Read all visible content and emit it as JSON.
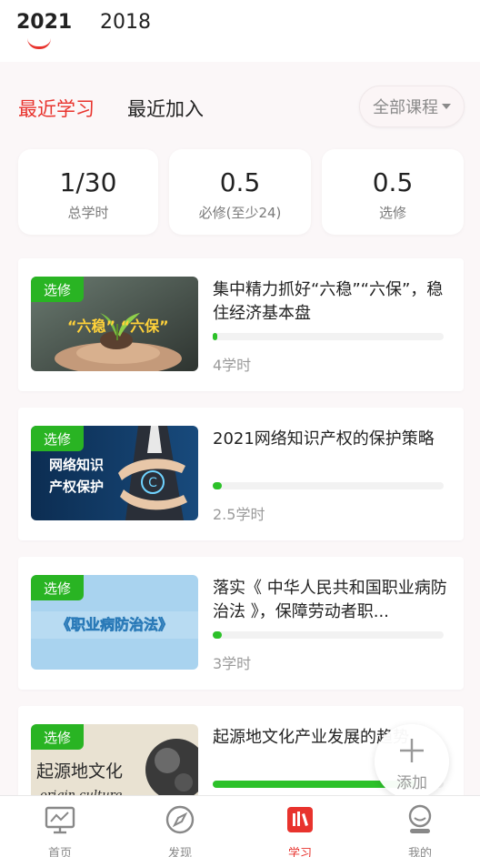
{
  "year_tabs": [
    {
      "label": "2021",
      "active": true
    },
    {
      "label": "2018",
      "active": false
    }
  ],
  "sub_tabs": [
    {
      "label": "最近学习",
      "active": true
    },
    {
      "label": "最近加入",
      "active": false
    }
  ],
  "course_filter": {
    "selected": "全部课程"
  },
  "stats": [
    {
      "value": "1/30",
      "label": "总学时"
    },
    {
      "value": "0.5",
      "label": "必修(至少24)"
    },
    {
      "value": "0.5",
      "label": "选修"
    }
  ],
  "courses": [
    {
      "badge": "选修",
      "title": "集中精力抓好“六稳”“六保”，稳住经济基本盘",
      "hours": "4学时",
      "progress": 0.02,
      "thumb_text": "“六稳” “六保”"
    },
    {
      "badge": "选修",
      "title": "2021网络知识产权的保护策略",
      "hours": "2.5学时",
      "progress": 0.04,
      "thumb_text_1": "网络知识",
      "thumb_text_2": "产权保护"
    },
    {
      "badge": "选修",
      "title": "落实《 中华人民共和国职业病防治法 》，保障劳动者职...",
      "hours": "3学时",
      "progress": 0.04,
      "thumb_text": "《职业病防治法》"
    },
    {
      "badge": "选修",
      "title": "起源地文化产业发展的趋势",
      "hours": "",
      "progress": 0.88,
      "thumb_text_1": "起源地文化",
      "thumb_text_2": "origin culture"
    }
  ],
  "fab": {
    "label": "添加"
  },
  "bottom_nav": [
    {
      "label": "首页",
      "icon": "monitor-icon",
      "active": false
    },
    {
      "label": "发现",
      "icon": "compass-icon",
      "active": false
    },
    {
      "label": "学习",
      "icon": "books-icon",
      "active": true
    },
    {
      "label": "我的",
      "icon": "user-icon",
      "active": false
    }
  ],
  "colors": {
    "accent": "#e8332d",
    "badge_green": "#29b423",
    "progress_green": "#2cc129"
  }
}
